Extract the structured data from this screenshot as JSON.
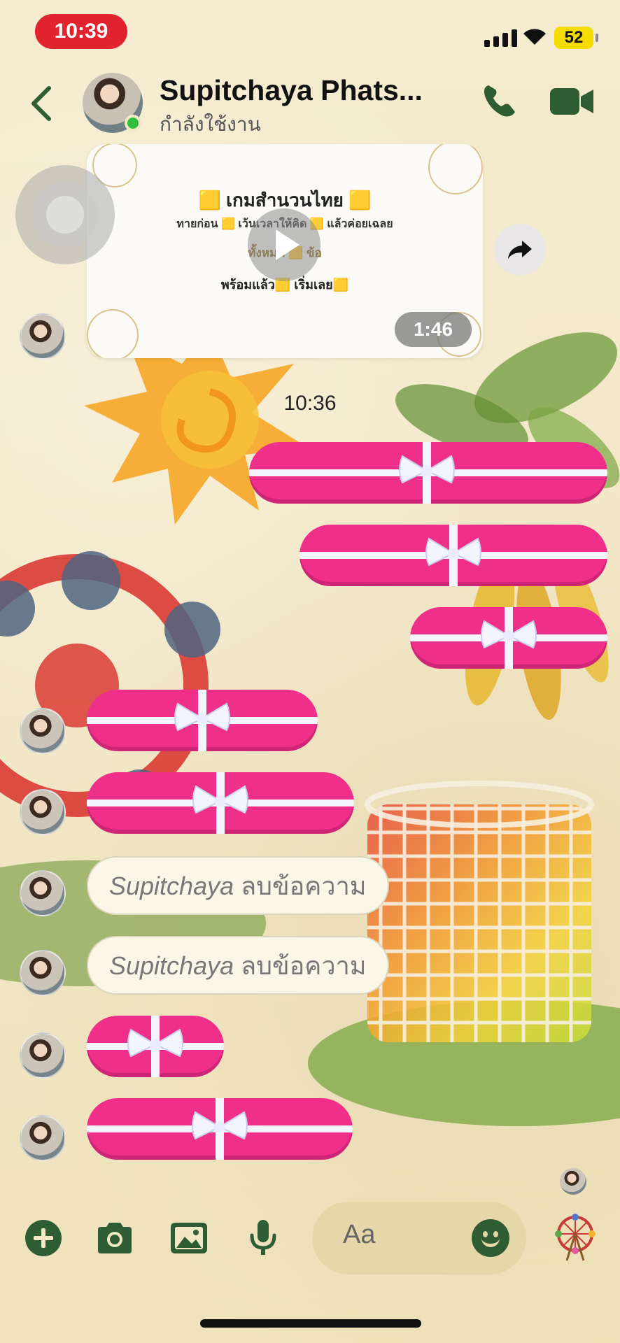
{
  "status_bar": {
    "time": "10:39",
    "battery": "52"
  },
  "header": {
    "contact_name": "Supitchaya Phats...",
    "contact_status": "กำลังใช้งาน"
  },
  "video_message": {
    "title": "🟨 เกมสำนวนไทย 🟨",
    "subtitle": "ทายก่อน 🟨 เว้นเวลาให้คิด 🟨 แล้วค่อยเฉลย",
    "count_line": "ทั้งหมด 🟨 ข้อ",
    "ready_line": "พร้อมแล้ว🟨 เริ่มเลย🟨",
    "duration": "1:46"
  },
  "timestamp": "10:36",
  "deleted_messages": [
    {
      "sender": "Supitchaya",
      "text": "ลบข้อความ"
    },
    {
      "sender": "Supitchaya",
      "text": "ลบข้อความ"
    }
  ],
  "composer": {
    "placeholder": "Aa"
  },
  "colors": {
    "accent": "#2e5d34",
    "gift_pink": "#ef2f8a",
    "time_pill": "#e0232e",
    "battery": "#f5dc00"
  },
  "icons": {
    "back": "chevron-left-icon",
    "call": "phone-icon",
    "video": "video-camera-icon",
    "forward": "share-arrow-icon",
    "add": "plus-circle-icon",
    "camera": "camera-icon",
    "gallery": "image-icon",
    "mic": "microphone-icon",
    "emoji": "smiley-icon",
    "theme": "ferris-wheel-icon"
  }
}
